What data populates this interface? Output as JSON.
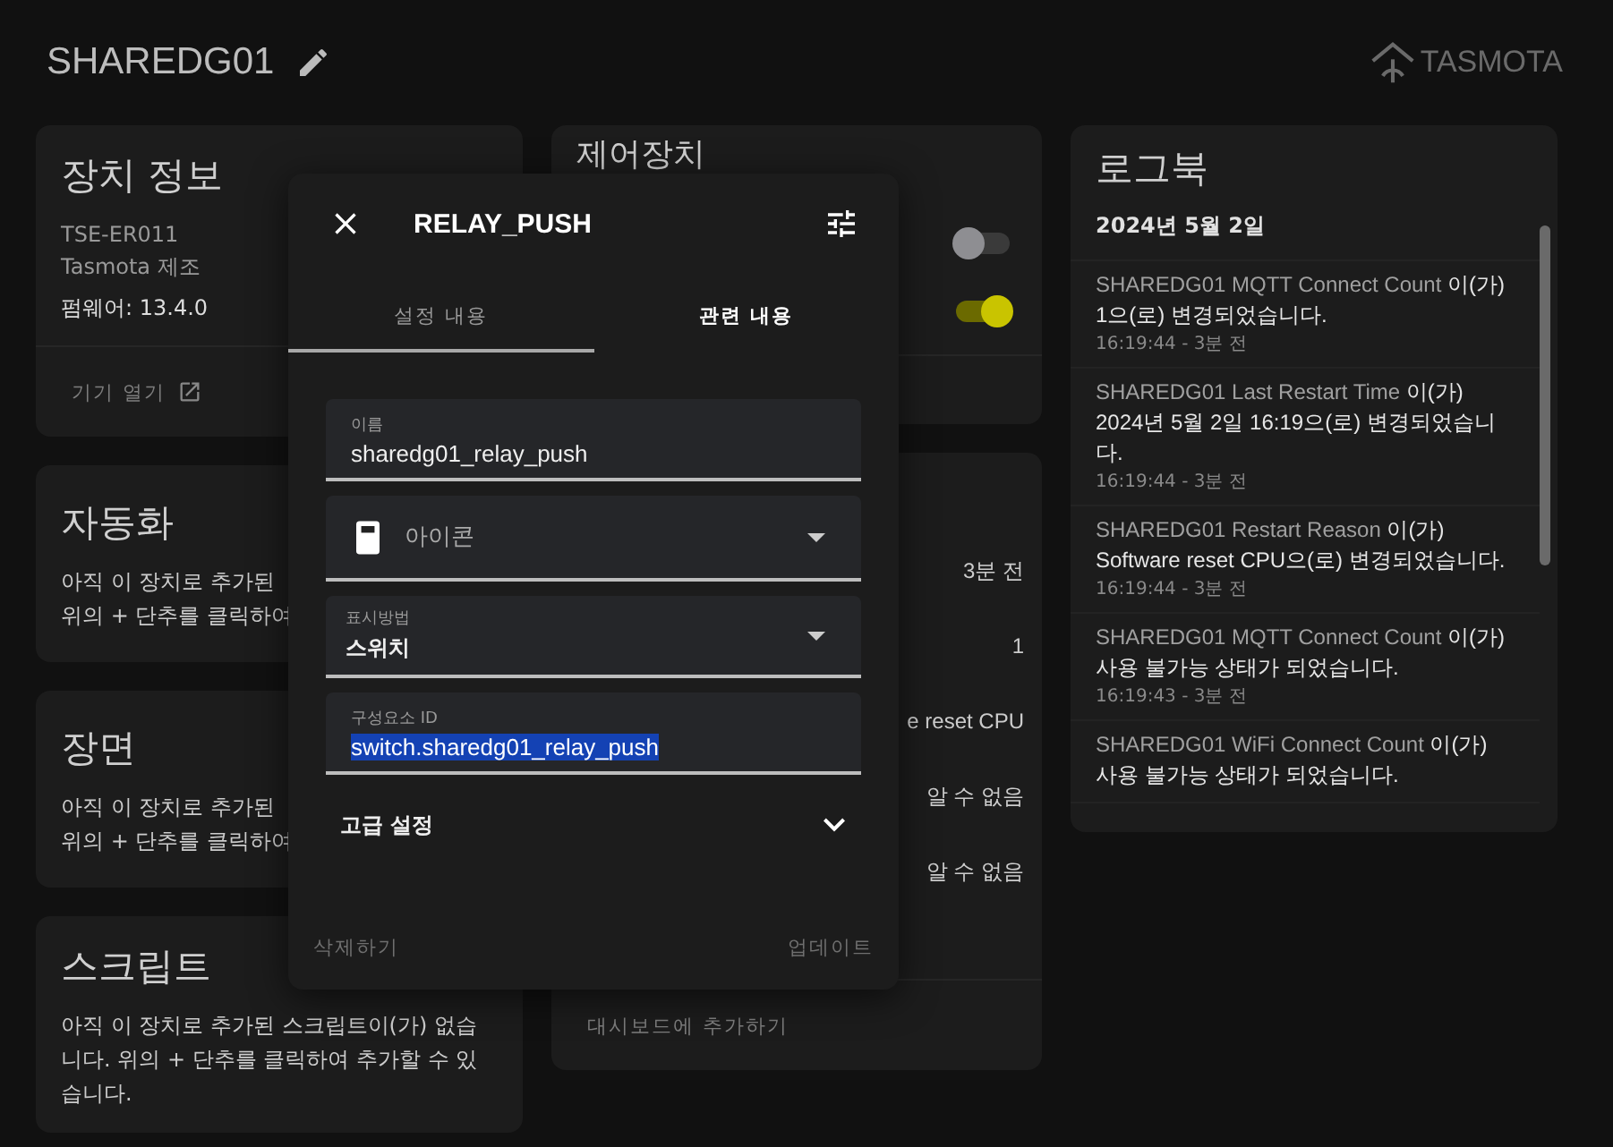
{
  "header": {
    "title": "SHAREDG01",
    "logo_text": "TASMOTA"
  },
  "device_info": {
    "title": "장치 정보",
    "model": "TSE-ER011",
    "manufacturer": "Tasmota 제조",
    "firmware": "펌웨어: 13.4.0",
    "action": "기기 열기"
  },
  "automations": {
    "title": "자동화",
    "lines": [
      "아직 이 장치로 추가된",
      "위의 + 단추를 클릭하여"
    ]
  },
  "scenes": {
    "title": "장면",
    "lines": [
      "아직 이 장치로 추가된",
      "위의 + 단추를 클릭하여"
    ]
  },
  "scripts": {
    "title": "스크립트",
    "text": "아직 이 장치로 추가된 스크립트이(가) 없습니다. 위의 + 단추를 클릭하여 추가할 수 있습니다."
  },
  "controls": {
    "title": "제어장치",
    "toggles": [
      {
        "on": false
      },
      {
        "on": true
      }
    ]
  },
  "diagnostics": {
    "values": [
      "3분 전",
      "1",
      "e reset CPU",
      "알 수 없음",
      "알 수 없음"
    ],
    "action": "대시보드에 추가하기"
  },
  "logbook": {
    "title": "로그북",
    "date": "2024년 5월 2일",
    "entries": [
      {
        "entity": "SHAREDG01 MQTT Connect Count",
        "message": " 이(가) 1으(로) 변경되었습니다.",
        "time": "16:19:44 - 3분 전"
      },
      {
        "entity": "SHAREDG01 Last Restart Time",
        "message": " 이(가) 2024년 5월 2일 16:19으(로) 변경되었습니다.",
        "time": "16:19:44 - 3분 전"
      },
      {
        "entity": "SHAREDG01 Restart Reason",
        "message": " 이(가) Software reset CPU으(로) 변경되었습니다.",
        "time": "16:19:44 - 3분 전"
      },
      {
        "entity": "SHAREDG01 MQTT Connect Count",
        "message": " 이(가) 사용 불가능 상태가 되었습니다.",
        "time": "16:19:43 - 3분 전"
      },
      {
        "entity": "SHAREDG01 WiFi Connect Count",
        "message": " 이(가) 사용 불가능 상태가 되었습니다."
      }
    ]
  },
  "dialog": {
    "title": "RELAY_PUSH",
    "tabs": [
      {
        "label": "설정 내용",
        "selected": true
      },
      {
        "label": "관련 내용",
        "selected": false
      }
    ],
    "fields": [
      {
        "kind": "text",
        "label": "이름",
        "value": "sharedg01_relay_push"
      },
      {
        "kind": "icon_select",
        "placeholder": "아이콘"
      },
      {
        "kind": "select",
        "label": "표시방법",
        "value": "스위치"
      },
      {
        "kind": "text",
        "label": "구성요소 ID",
        "value": "switch.sharedg01_relay_push",
        "text_selected": true
      }
    ],
    "advanced": {
      "label": "고급 설정",
      "expanded": false
    },
    "buttons": [
      "삭제하기",
      "업데이트"
    ]
  }
}
